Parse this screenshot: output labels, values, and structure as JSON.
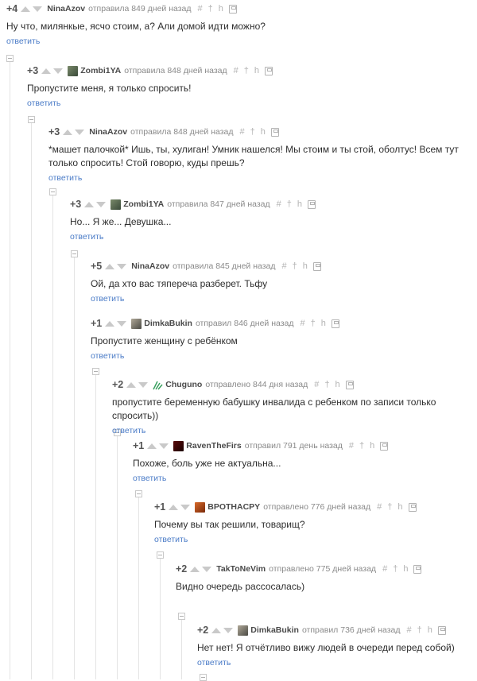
{
  "reply_label": "ответить",
  "comments": [
    {
      "rating": "+4",
      "author": "NinaAzov",
      "meta": "отправила 849 дней назад",
      "text": "Ну что, милянкые, ясчо стоим, а? Али домой идти можно?"
    },
    {
      "rating": "+3",
      "author": "Zombi1YA",
      "meta": "отправила 848 дней назад",
      "text": "Пропустите меня, я только спросить!"
    },
    {
      "rating": "+3",
      "author": "NinaAzov",
      "meta": "отправила 848 дней назад",
      "text": "*машет палочкой* Ишь, ты, хулиган! Умник нашелся! Мы стоим и ты стой, оболтус! Всем тут только спросить! Стой говорю, куды прешь?"
    },
    {
      "rating": "+3",
      "author": "Zombi1YA",
      "meta": "отправила 847 дней назад",
      "text": "Но... Я же... Девушка..."
    },
    {
      "rating": "+5",
      "author": "NinaAzov",
      "meta": "отправила 845 дней назад",
      "text": "Ой, да хто вас тяпереча разберет. Тьфу"
    },
    {
      "rating": "+1",
      "author": "DimkaBukin",
      "meta": "отправил 846 дней назад",
      "text": "Пропустите женщину с ребёнком"
    },
    {
      "rating": "+2",
      "author": "Chuguno",
      "meta": "отправлено 844 дня назад",
      "text": "пропустите беременную бабушку инвалида с ребенком по записи только спросить))"
    },
    {
      "rating": "+1",
      "author": "RavenTheFirs",
      "meta": "отправил 791 день назад",
      "text": "Похоже, боль уже не актуальна..."
    },
    {
      "rating": "+1",
      "author": "BPOTHACPY",
      "meta": "отправлено 776 дней назад",
      "text": "Почему вы так решили, товарищ?"
    },
    {
      "rating": "+2",
      "author": "TakToNeVim",
      "meta": "отправлено 775 дней назад",
      "text": "Видно очередь рассосалась)"
    },
    {
      "rating": "+2",
      "author": "DimkaBukin",
      "meta": "отправил 736 дней назад",
      "text": "Нет нет! Я отчётливо вижу людей в очереди перед собой)"
    }
  ]
}
